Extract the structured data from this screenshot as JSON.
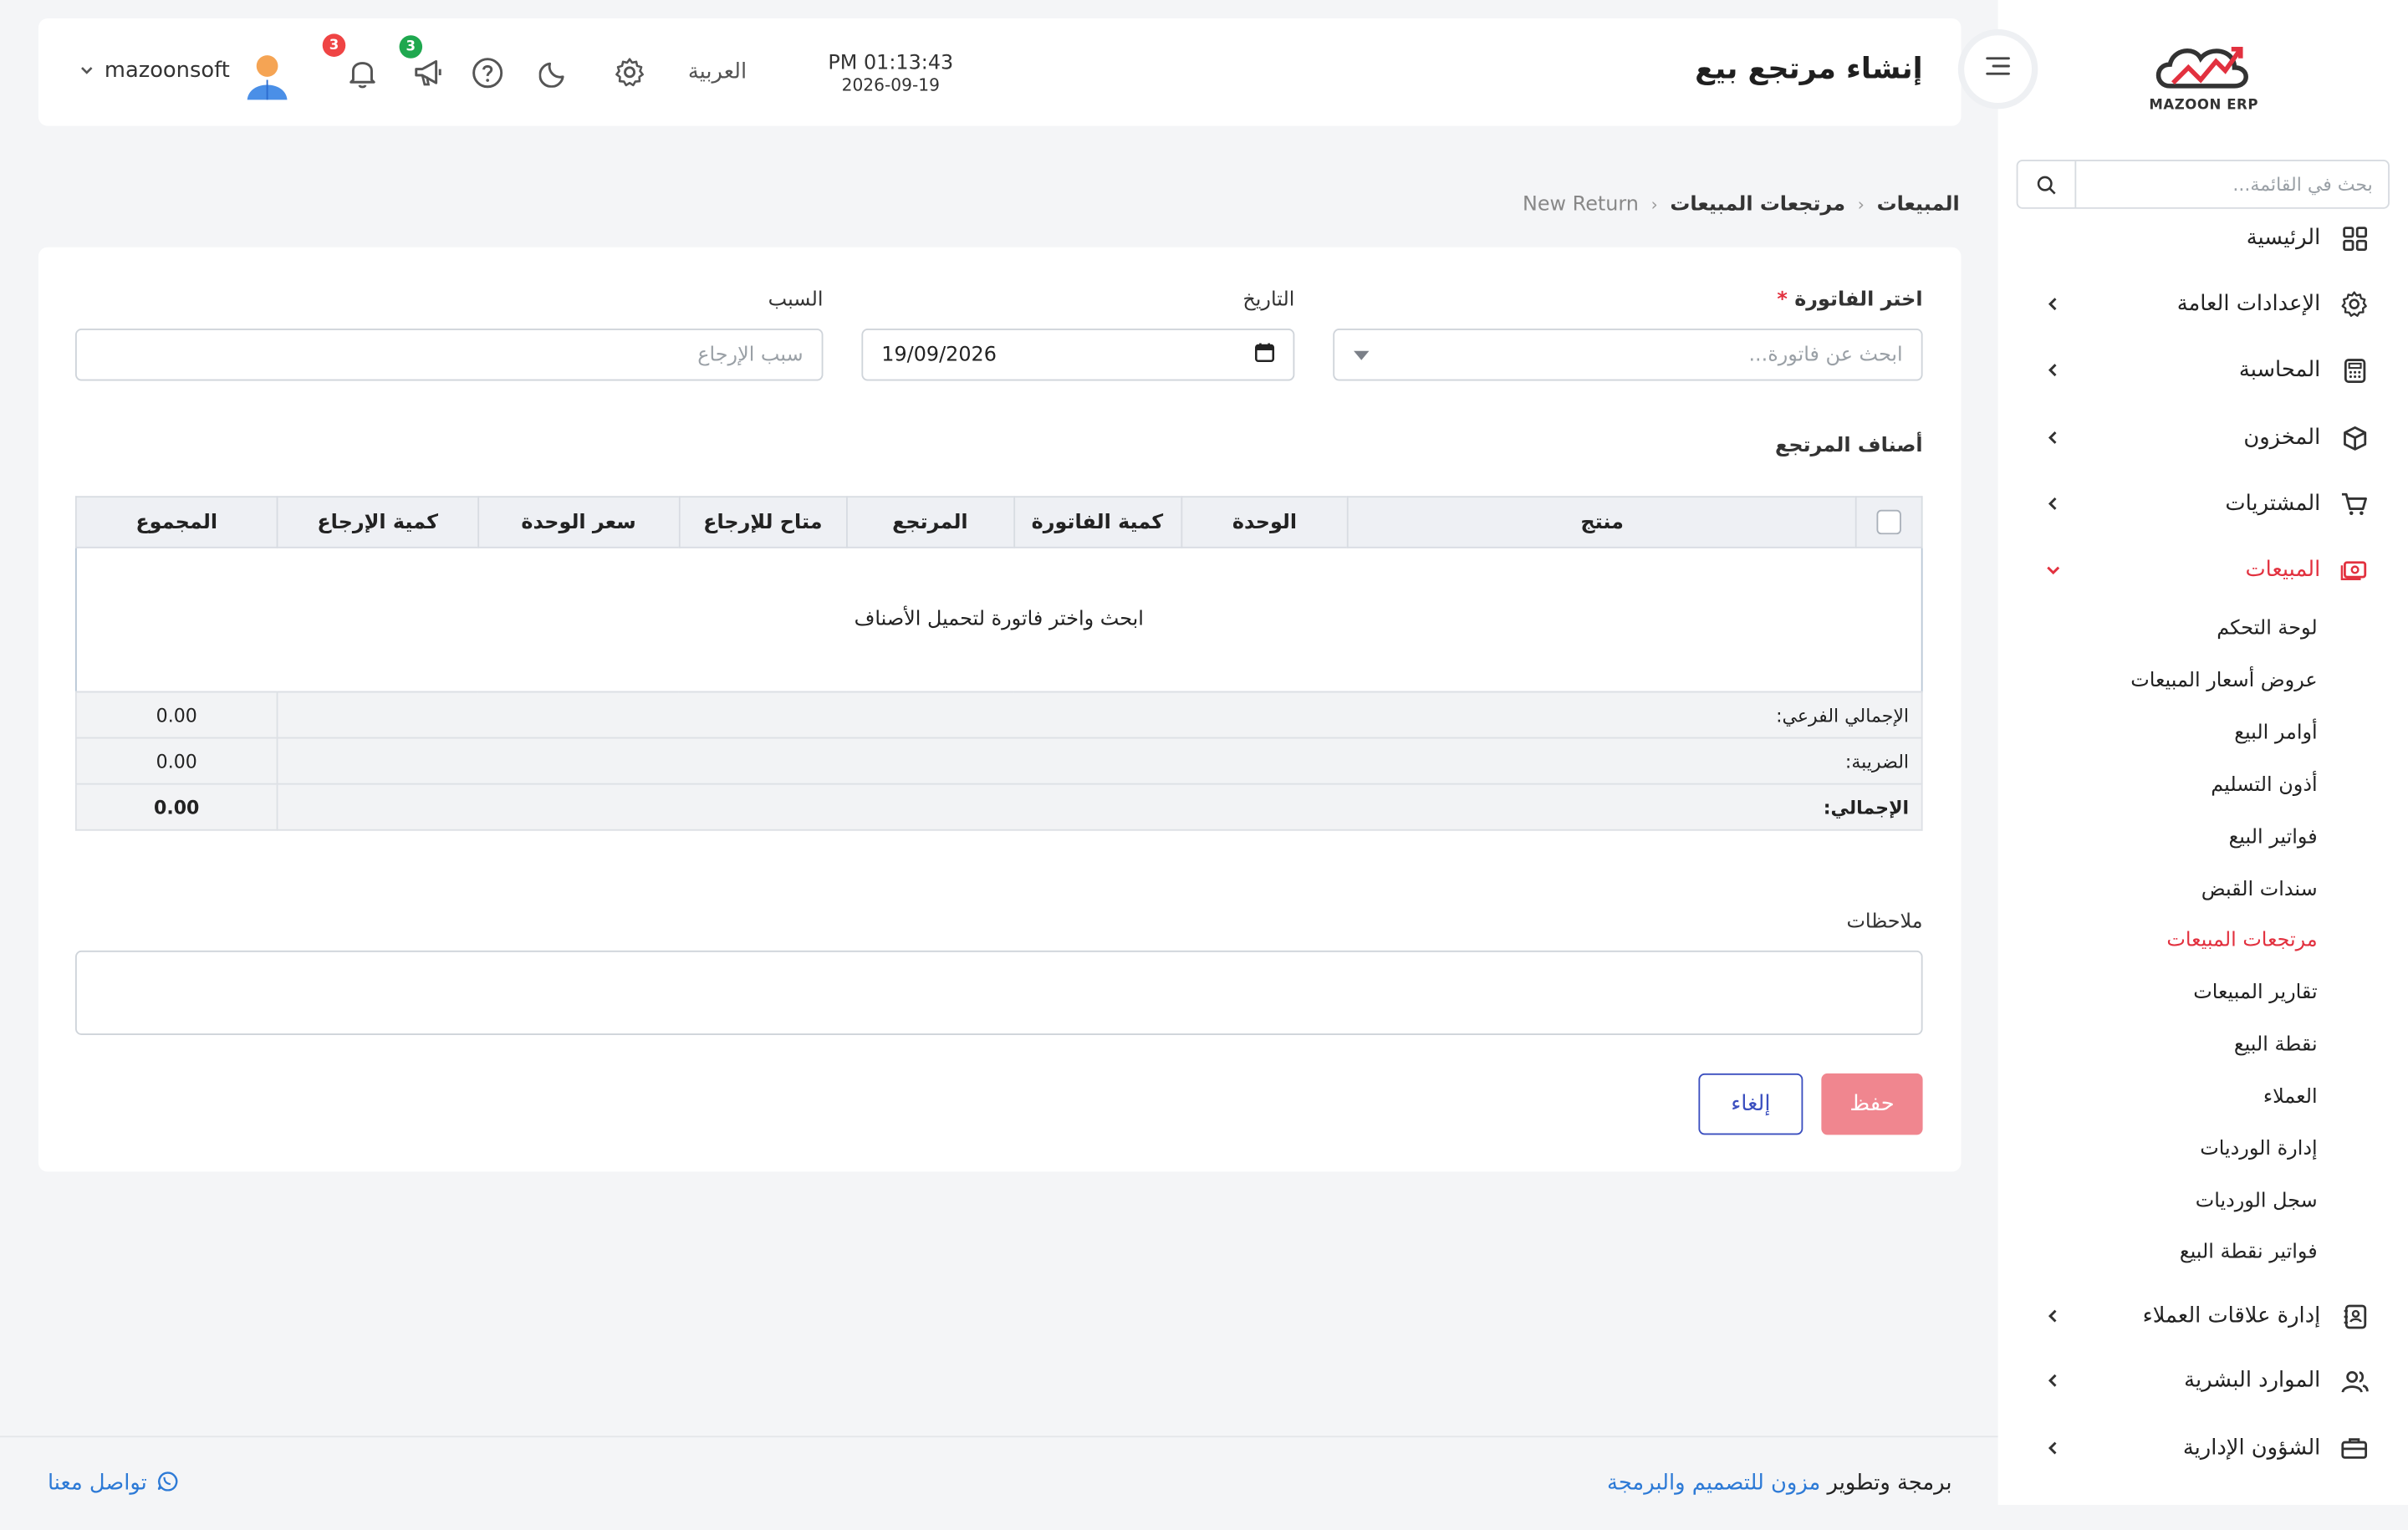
{
  "app": {
    "logo_text": "MAZOON ERP",
    "page_title": "إنشاء مرتجع بيع"
  },
  "header": {
    "time": "PM 01:13:43",
    "date": "2026-09-19",
    "language": "العربية",
    "notifications_count": "3",
    "announcements_count": "3",
    "username": "mazoonsoft",
    "icons": [
      "sidebar-toggle-icon",
      "settings-icon",
      "moon-icon",
      "help-icon",
      "megaphone-icon",
      "bell-icon",
      "avatar",
      "chevron-down-icon"
    ]
  },
  "sidebar": {
    "search_placeholder": "بحث في القائمة...",
    "items": [
      {
        "label": "الرئيسية",
        "icon": "grid-icon"
      },
      {
        "label": "الإعدادات العامة",
        "icon": "gear-icon"
      },
      {
        "label": "المحاسبة",
        "icon": "calculator-icon"
      },
      {
        "label": "المخزون",
        "icon": "box-icon"
      },
      {
        "label": "المشتريات",
        "icon": "cart-icon"
      },
      {
        "label": "المبيعات",
        "icon": "cash-icon"
      },
      {
        "label": "إدارة علاقات العملاء",
        "icon": "contacts-icon"
      },
      {
        "label": "الموارد البشرية",
        "icon": "users-icon"
      },
      {
        "label": "الشؤون الإدارية",
        "icon": "briefcase-icon"
      }
    ],
    "sales_subitems": [
      "لوحة التحكم",
      "عروض أسعار المبيعات",
      "أوامر البيع",
      "أذون التسليم",
      "فواتير البيع",
      "سندات القبض",
      "مرتجعات المبيعات",
      "تقارير المبيعات",
      "نقطة البيع",
      "العملاء",
      "إدارة الورديات",
      "سجل الورديات",
      "فواتير نقطة البيع"
    ],
    "active_subitem": "مرتجعات المبيعات",
    "accent_color": "#e2313f"
  },
  "breadcrumb": [
    "المبيعات",
    "مرتجعات المبيعات",
    "New Return"
  ],
  "form": {
    "invoice_label": "اختر الفاتورة",
    "invoice_required_mark": "*",
    "invoice_placeholder": "ابحث عن فاتورة...",
    "date_label": "التاريخ",
    "date_value": "19/09/2026",
    "reason_label": "السبب",
    "reason_placeholder": "سبب الإرجاع",
    "items_title": "أصناف المرتجع",
    "columns": [
      "منتج",
      "الوحدة",
      "كمية الفاتورة",
      "المرتجع",
      "متاح للإرجاع",
      "سعر الوحدة",
      "كمية الإرجاع",
      "المجموع"
    ],
    "empty_message": "ابحث واختر فاتورة لتحميل الأصناف",
    "totals": [
      {
        "label": "الإجمالي الفرعي:",
        "value": "0.00"
      },
      {
        "label": "الضريبة:",
        "value": "0.00"
      },
      {
        "label": "الإجمالي:",
        "value": "0.00"
      }
    ],
    "notes_label": "ملاحظات",
    "save_label": "حفظ",
    "cancel_label": "إلغاء"
  },
  "footer": {
    "credit_prefix": "برمجة وتطوير",
    "credit_brand": "مزون للتصميم والبرمجة",
    "contact_label": "تواصل معنا"
  }
}
